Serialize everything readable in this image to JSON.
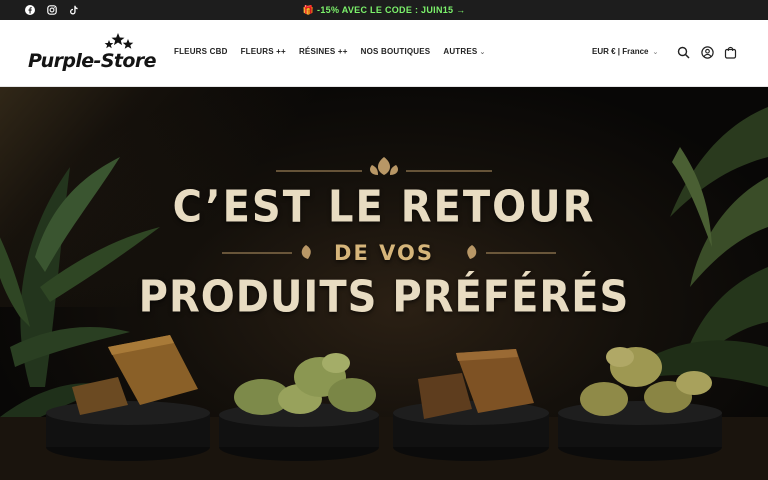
{
  "announcement": {
    "promo_text": "-15% AVEC LE CODE : JUIN15 →",
    "gift_icon": "gift-icon",
    "social_icons": [
      "facebook-icon",
      "instagram-icon",
      "tiktok-icon"
    ],
    "accent_color": "#7cf26b"
  },
  "header": {
    "logo_text": "Purple-Store",
    "nav": [
      {
        "label": "FLEURS CBD",
        "has_dropdown": false
      },
      {
        "label": "FLEURS ++",
        "has_dropdown": false
      },
      {
        "label": "RÉSINES ++",
        "has_dropdown": false
      },
      {
        "label": "NOS BOUTIQUES",
        "has_dropdown": false
      },
      {
        "label": "AUTRES",
        "has_dropdown": true
      }
    ],
    "currency": "EUR € | France",
    "icons": [
      "search-icon",
      "account-icon",
      "cart-icon"
    ]
  },
  "hero": {
    "line1": "C’EST LE RETOUR",
    "line2": "DE VOS",
    "line3": "PRODUITS PRÉFÉRÉS",
    "text_color": "#e8dcc2",
    "accent_color": "#d6b57a"
  }
}
